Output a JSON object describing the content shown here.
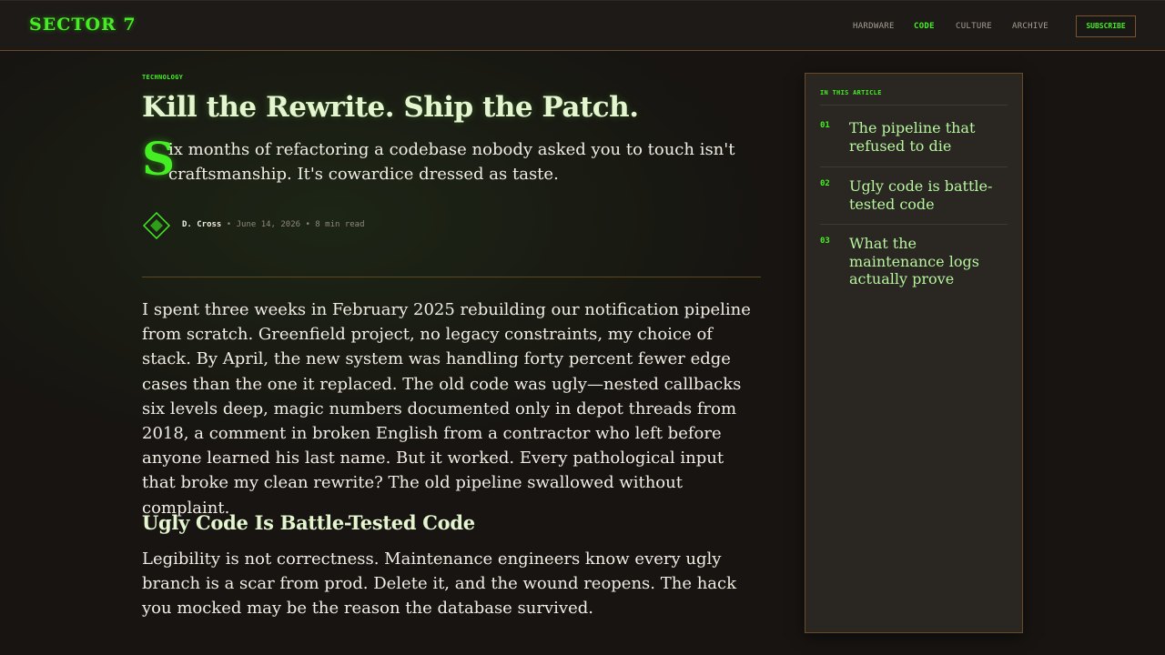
{
  "header": {
    "logo": "SECTOR 7",
    "nav": [
      {
        "label": "HARDWARE",
        "active": false
      },
      {
        "label": "CODE",
        "active": true
      },
      {
        "label": "CULTURE",
        "active": false
      },
      {
        "label": "ARCHIVE",
        "active": false
      }
    ],
    "subscribe_label": "SUBSCRIBE"
  },
  "article": {
    "category": "TECHNOLOGY",
    "title": "Kill the Rewrite. Ship the Patch.",
    "lede_dropcap": "S",
    "lede_rest": "ix months of refactoring a codebase nobody asked you to touch isn't craftsmanship. It's cowardice dressed as taste.",
    "author": "D. Cross",
    "meta_rest": " • June 14, 2026 • 8 min read",
    "avatar_icon": "diamond-icon",
    "paragraph_1": "I spent three weeks in February 2025 rebuilding our notification pipeline from scratch. Greenfield project, no legacy constraints, my choice of stack. By April, the new system was handling forty percent fewer edge cases than the one it replaced. The old code was ugly—nested callbacks six levels deep, magic numbers documented only in depot threads from 2018, a comment in broken English from a contractor who left before anyone learned his last name. But it worked. Every pathological input that broke my clean rewrite? The old pipeline swallowed without complaint.",
    "heading_2": "Ugly Code Is Battle-Tested Code",
    "paragraph_2": "Legibility is not correctness. Maintenance engineers know every ugly branch is a scar from prod. Delete it, and the wound reopens. The hack you mocked may be the reason the database survived."
  },
  "toc": {
    "label": "IN THIS ARTICLE",
    "items": [
      {
        "num": "01",
        "text": "The pipeline that refused to die"
      },
      {
        "num": "02",
        "text": "Ugly code is battle-tested code"
      },
      {
        "num": "03",
        "text": "What the maintenance logs actually prove"
      }
    ]
  },
  "colors": {
    "accent": "#44ee22",
    "background": "#171411",
    "panel": "#2a2622",
    "border": "#6b4a2a",
    "toc_text": "#b6f59e"
  }
}
